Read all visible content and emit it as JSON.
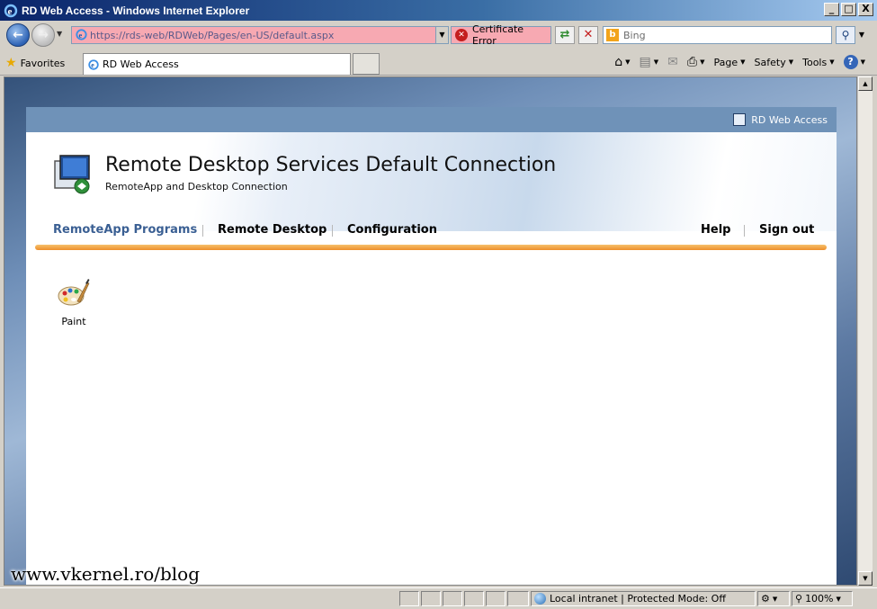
{
  "window": {
    "title": "RD Web Access - Windows Internet Explorer",
    "min": "_",
    "max": "□",
    "close": "X"
  },
  "address": {
    "url": "https://rds-web/RDWeb/Pages/en-US/default.aspx",
    "cert_error": "Certificate Error"
  },
  "search": {
    "placeholder": "Bing",
    "brand": "b"
  },
  "favorites": {
    "label": "Favorites"
  },
  "tab": {
    "label": "RD Web Access"
  },
  "commands": {
    "page": "Page",
    "safety": "Safety",
    "tools": "Tools",
    "help": "?"
  },
  "rd": {
    "header_link": "RD Web Access",
    "title": "Remote Desktop Services Default Connection",
    "subtitle": "RemoteApp and Desktop Connection",
    "nav": {
      "remoteapp": "RemoteApp Programs",
      "remote_desktop": "Remote Desktop",
      "configuration": "Configuration",
      "help": "Help",
      "signout": "Sign out"
    },
    "apps": [
      {
        "label": "Paint"
      }
    ]
  },
  "status": {
    "zone": "Local intranet | Protected Mode: Off",
    "zoom": "100%"
  },
  "watermark": "www.vkernel.ro/blog",
  "colors": {
    "accent": "#3a5f93",
    "orange": "#ee8f2a",
    "cert_bg": "#f7a9b2"
  }
}
